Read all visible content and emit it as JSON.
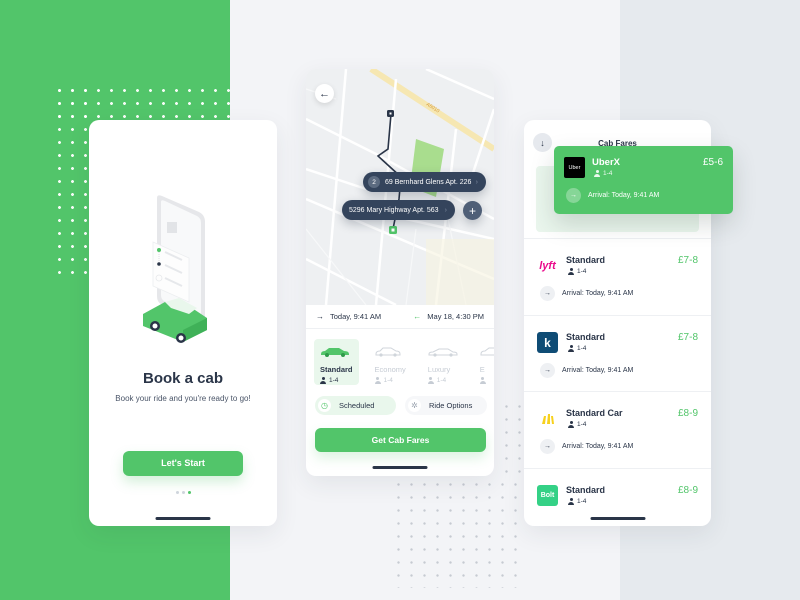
{
  "colors": {
    "brand_green": "#52c56a",
    "navy": "#2a3548",
    "pill_dark": "#34445c"
  },
  "onboarding": {
    "title": "Book a cab",
    "subtitle": "Book your ride and you're ready to go!",
    "start_button": "Let's Start",
    "pager": {
      "total": 3,
      "active": 3
    }
  },
  "booking": {
    "back_icon": "arrow-left-icon",
    "map": {
      "road_label": "A6010",
      "stops": [
        {
          "number": "2",
          "address": "69 Bernhard Glens Apt. 226"
        },
        {
          "number": "",
          "address": "5296 Mary Highway Apt. 563"
        }
      ],
      "add_stop_icon": "plus-icon"
    },
    "times": {
      "depart": "Today, 9:41 AM",
      "return": "May 18, 4:30 PM"
    },
    "ride_types": [
      {
        "name": "Standard",
        "capacity": "1-4",
        "selected": true
      },
      {
        "name": "Economy",
        "capacity": "1-4",
        "selected": false
      },
      {
        "name": "Luxury",
        "capacity": "1-4",
        "selected": false
      },
      {
        "name": "E",
        "capacity": "",
        "selected": false
      }
    ],
    "options": {
      "scheduled": "Scheduled",
      "ride_options": "Ride Options"
    },
    "cta": "Get Cab Fares"
  },
  "fares": {
    "title": "Cab Fares",
    "highlighted": {
      "provider": "Uber",
      "name": "UberX",
      "capacity": "1-4",
      "price": "£5-6",
      "arrival": "Arrival: Today, 9:41 AM"
    },
    "items": [
      {
        "provider": "lyft",
        "name": "Standard",
        "capacity": "1-4",
        "price": "£7-8",
        "arrival": "Arrival: Today, 9:41 AM"
      },
      {
        "provider": "k",
        "name": "Standard",
        "capacity": "1-4",
        "price": "£7-8",
        "arrival": "Arrival: Today, 9:41 AM"
      },
      {
        "provider": "",
        "name": "Standard Car",
        "capacity": "1-4",
        "price": "£8-9",
        "arrival": "Arrival: Today, 9:41 AM"
      },
      {
        "provider": "Bolt",
        "name": "Standard",
        "capacity": "1-4",
        "price": "£8-9",
        "arrival": ""
      }
    ]
  }
}
